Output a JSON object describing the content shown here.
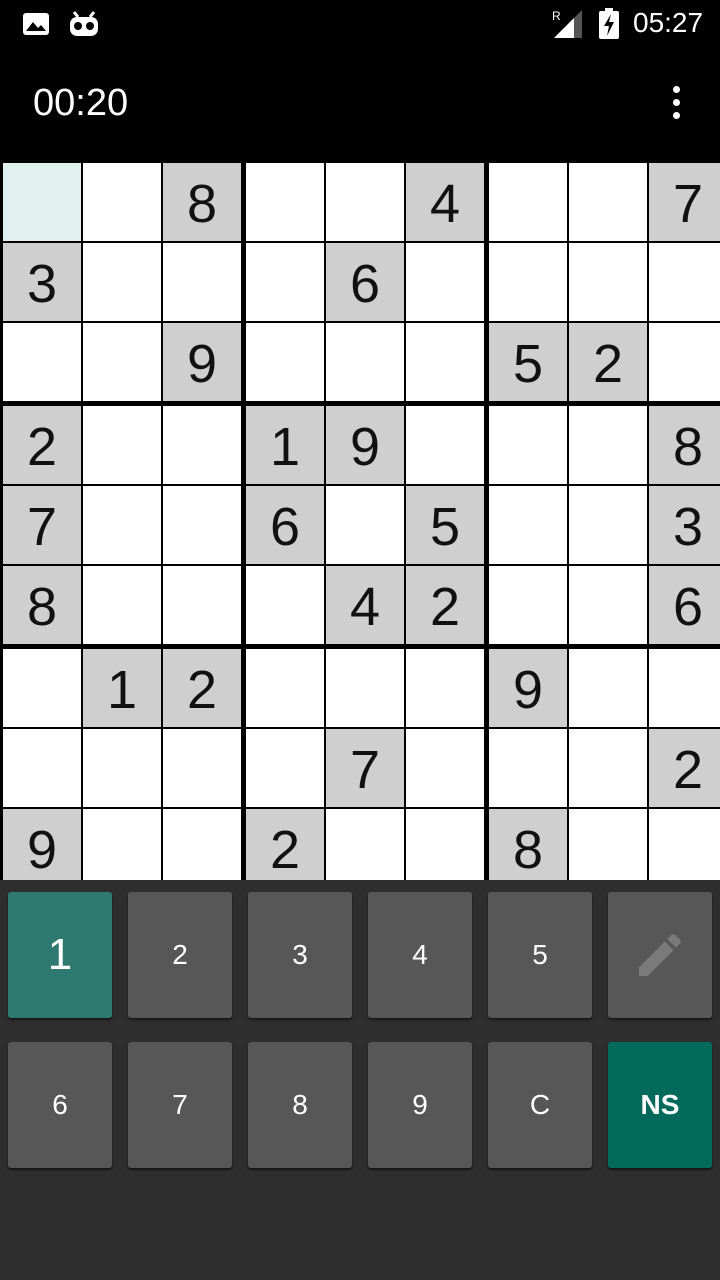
{
  "status_bar": {
    "time": "05:27",
    "signal_label": "R"
  },
  "app_bar": {
    "timer": "00:20",
    "menu_icon": "overflow-menu-icon"
  },
  "board": {
    "grid": [
      [
        "",
        "",
        "8",
        "",
        "",
        "4",
        "",
        "",
        "7"
      ],
      [
        "3",
        "",
        "",
        "",
        "6",
        "",
        "",
        "",
        ""
      ],
      [
        "",
        "",
        "9",
        "",
        "",
        "",
        "5",
        "2",
        ""
      ],
      [
        "2",
        "",
        "",
        "1",
        "9",
        "",
        "",
        "",
        "8"
      ],
      [
        "7",
        "",
        "",
        "6",
        "",
        "5",
        "",
        "",
        "3"
      ],
      [
        "8",
        "",
        "",
        "",
        "4",
        "2",
        "",
        "",
        "6"
      ],
      [
        "",
        "1",
        "2",
        "",
        "",
        "",
        "9",
        "",
        ""
      ],
      [
        "",
        "",
        "",
        "",
        "7",
        "",
        "",
        "",
        "2"
      ],
      [
        "9",
        "",
        "",
        "2",
        "",
        "",
        "8",
        "",
        ""
      ]
    ],
    "selected_cell": [
      0,
      0
    ]
  },
  "keypad": {
    "keys": [
      "1",
      "2",
      "3",
      "4",
      "5",
      "",
      "6",
      "7",
      "8",
      "9",
      "C",
      "NS"
    ],
    "active_key": "1",
    "pencil_icon": "pencil-icon"
  },
  "colors": {
    "active_key": "#2f7a70",
    "ns_key": "#036a5b",
    "key": "#575757",
    "given_cell": "#cfcfcf",
    "selected_cell": "#e0f1f0"
  }
}
